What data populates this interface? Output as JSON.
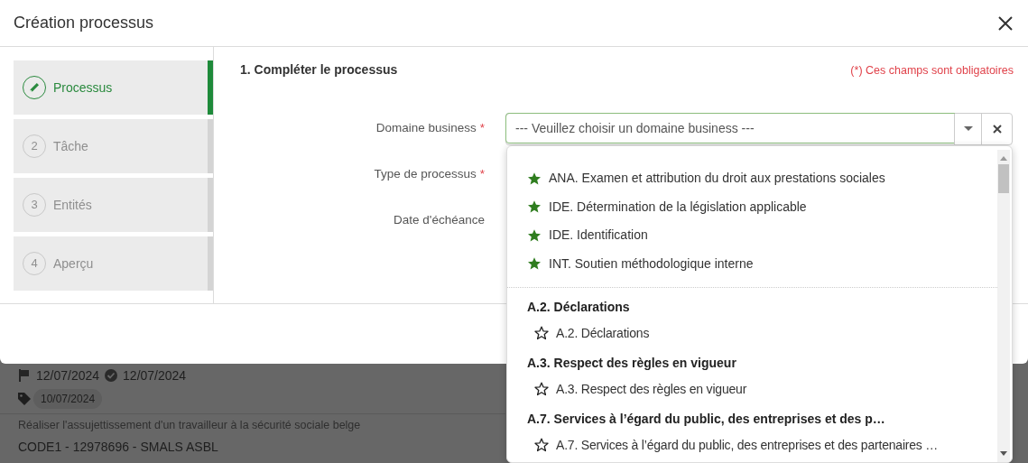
{
  "background_list": {
    "rows": [
      {
        "flag_date": "12/07/2024",
        "done_date": "12/07/2024",
        "tag": "10/07/2024"
      },
      {
        "description": "Réaliser l'assujettissement d'un travailleur à la sécurité sociale belge",
        "title": "CODE1 - 12978696 - SMALS ASBL"
      }
    ]
  },
  "dialog": {
    "title": "Création processus",
    "steps": [
      {
        "label": "Processus",
        "selected": true
      },
      {
        "number": "2",
        "label": "Tâche",
        "selected": false
      },
      {
        "number": "3",
        "label": "Entités",
        "selected": false
      },
      {
        "number": "4",
        "label": "Aperçu",
        "selected": false
      }
    ],
    "section_title": "1. Compléter le processus",
    "required_note": "(*) Ces champs sont obligatoires",
    "fields": [
      {
        "label": "Domaine business",
        "required": true
      },
      {
        "label": "Type de processus",
        "required": true
      },
      {
        "label": "Date d'échéance",
        "required": false
      }
    ],
    "required_mark": "*",
    "select": {
      "placeholder": "--- Veuillez choisir un domaine business ---",
      "favorites": [
        {
          "label": "ANA. Examen et attribution du droit aux prestations sociales",
          "starred": true
        },
        {
          "label": "IDE. Détermination de la législation applicable",
          "starred": true
        },
        {
          "label": "IDE. Identification",
          "starred": true
        },
        {
          "label": "INT. Soutien méthodologique interne",
          "starred": true
        }
      ],
      "groups": [
        {
          "title": "A.2. Déclarations",
          "items": [
            {
              "label": "A.2. Déclarations",
              "starred": false
            }
          ]
        },
        {
          "title": "A.3. Respect des règles en vigueur",
          "items": [
            {
              "label": "A.3. Respect des règles en vigueur",
              "starred": false
            }
          ]
        },
        {
          "title": "A.7. Services à l’égard du public, des entreprises et des p…",
          "items": [
            {
              "label": "A.7. Services à l’égard du public, des entreprises et des partenaires …",
              "starred": false
            }
          ]
        }
      ]
    }
  }
}
